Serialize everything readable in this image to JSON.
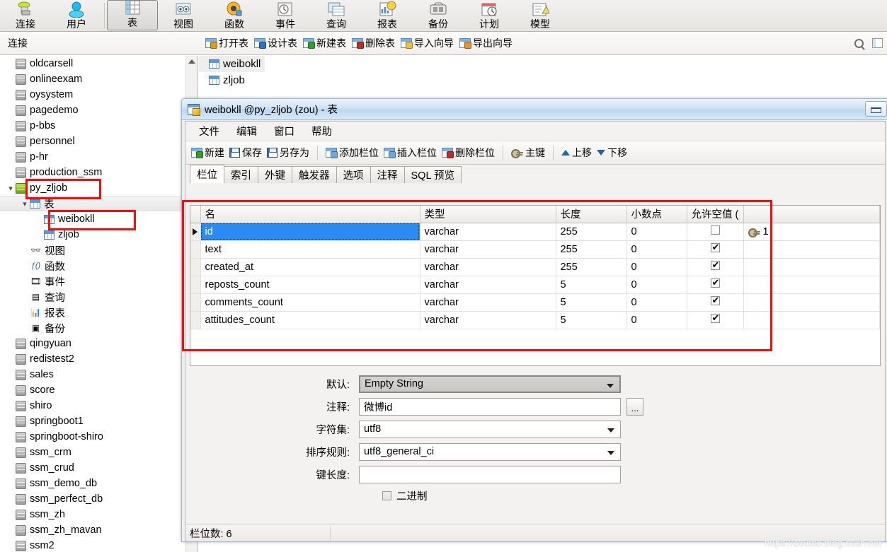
{
  "ribbon": {
    "items": [
      {
        "label": "连接",
        "icon": "connection-icon",
        "selected": false
      },
      {
        "label": "用户",
        "icon": "user-icon",
        "selected": false
      },
      {
        "label": "表",
        "icon": "table-icon",
        "selected": true
      },
      {
        "label": "视图",
        "icon": "view-icon",
        "selected": false
      },
      {
        "label": "函数",
        "icon": "function-icon",
        "selected": false
      },
      {
        "label": "事件",
        "icon": "event-icon",
        "selected": false
      },
      {
        "label": "查询",
        "icon": "query-icon",
        "selected": false
      },
      {
        "label": "报表",
        "icon": "report-icon",
        "selected": false
      },
      {
        "label": "备份",
        "icon": "backup-icon",
        "selected": false
      },
      {
        "label": "计划",
        "icon": "schedule-icon",
        "selected": false
      },
      {
        "label": "模型",
        "icon": "model-icon",
        "selected": false
      }
    ]
  },
  "strip": {
    "left_label": "连接",
    "actions": [
      {
        "label": "打开表",
        "icon": "open-table-icon"
      },
      {
        "label": "设计表",
        "icon": "design-table-icon"
      },
      {
        "label": "新建表",
        "icon": "new-table-icon"
      },
      {
        "label": "删除表",
        "icon": "delete-table-icon"
      },
      {
        "label": "导入向导",
        "icon": "import-wizard-icon"
      },
      {
        "label": "导出向导",
        "icon": "export-wizard-icon"
      }
    ],
    "search_icon": "search-icon",
    "grid_icon": "grid-view-icon"
  },
  "tree": {
    "items": [
      {
        "label": "oldcarsell",
        "indent": 1,
        "icon": "database-icon",
        "twisty": "",
        "highlight": false
      },
      {
        "label": "onlineexam",
        "indent": 1,
        "icon": "database-icon",
        "twisty": "",
        "highlight": false
      },
      {
        "label": "oysystem",
        "indent": 1,
        "icon": "database-icon",
        "twisty": "",
        "highlight": false
      },
      {
        "label": "pagedemo",
        "indent": 1,
        "icon": "database-icon",
        "twisty": "",
        "highlight": false
      },
      {
        "label": "p-bbs",
        "indent": 1,
        "icon": "database-icon",
        "twisty": "",
        "highlight": false
      },
      {
        "label": "personnel",
        "indent": 1,
        "icon": "database-icon",
        "twisty": "",
        "highlight": false
      },
      {
        "label": "p-hr",
        "indent": 1,
        "icon": "database-icon",
        "twisty": "",
        "highlight": false
      },
      {
        "label": "production_ssm",
        "indent": 1,
        "icon": "database-icon",
        "twisty": "",
        "highlight": false
      },
      {
        "label": "py_zljob",
        "indent": 1,
        "icon": "database-open-icon",
        "twisty": "expanded",
        "highlight": false
      },
      {
        "label": "表",
        "indent": 2,
        "icon": "table-folder-icon",
        "twisty": "expanded",
        "highlight": true
      },
      {
        "label": "weibokll",
        "indent": 3,
        "icon": "table-icon",
        "twisty": "",
        "highlight": false
      },
      {
        "label": "zljob",
        "indent": 3,
        "icon": "table-icon",
        "twisty": "",
        "highlight": false
      },
      {
        "label": "视图",
        "indent": 2,
        "icon": "view-icon",
        "twisty": "",
        "highlight": false
      },
      {
        "label": "函数",
        "indent": 2,
        "icon": "function-icon",
        "twisty": "",
        "highlight": false
      },
      {
        "label": "事件",
        "indent": 2,
        "icon": "event-icon",
        "twisty": "",
        "highlight": false
      },
      {
        "label": "查询",
        "indent": 2,
        "icon": "query-icon",
        "twisty": "",
        "highlight": false
      },
      {
        "label": "报表",
        "indent": 2,
        "icon": "report-icon",
        "twisty": "",
        "highlight": false
      },
      {
        "label": "备份",
        "indent": 2,
        "icon": "backup-icon",
        "twisty": "",
        "highlight": false
      },
      {
        "label": "qingyuan",
        "indent": 1,
        "icon": "database-icon",
        "twisty": "",
        "highlight": false
      },
      {
        "label": "redistest2",
        "indent": 1,
        "icon": "database-icon",
        "twisty": "",
        "highlight": false
      },
      {
        "label": "sales",
        "indent": 1,
        "icon": "database-icon",
        "twisty": "",
        "highlight": false
      },
      {
        "label": "score",
        "indent": 1,
        "icon": "database-icon",
        "twisty": "",
        "highlight": false
      },
      {
        "label": "shiro",
        "indent": 1,
        "icon": "database-icon",
        "twisty": "",
        "highlight": false
      },
      {
        "label": "springboot1",
        "indent": 1,
        "icon": "database-icon",
        "twisty": "",
        "highlight": false
      },
      {
        "label": "springboot-shiro",
        "indent": 1,
        "icon": "database-icon",
        "twisty": "",
        "highlight": false
      },
      {
        "label": "ssm_crm",
        "indent": 1,
        "icon": "database-icon",
        "twisty": "",
        "highlight": false
      },
      {
        "label": "ssm_crud",
        "indent": 1,
        "icon": "database-icon",
        "twisty": "",
        "highlight": false
      },
      {
        "label": "ssm_demo_db",
        "indent": 1,
        "icon": "database-icon",
        "twisty": "",
        "highlight": false
      },
      {
        "label": "ssm_perfect_db",
        "indent": 1,
        "icon": "database-icon",
        "twisty": "",
        "highlight": false
      },
      {
        "label": "ssm_zh",
        "indent": 1,
        "icon": "database-icon",
        "twisty": "",
        "highlight": false
      },
      {
        "label": "ssm_zh_mavan",
        "indent": 1,
        "icon": "database-icon",
        "twisty": "",
        "highlight": false
      },
      {
        "label": "ssm2",
        "indent": 1,
        "icon": "database-icon",
        "twisty": "",
        "highlight": false
      }
    ]
  },
  "object_list": {
    "items": [
      {
        "label": "weibokll",
        "selected": true
      },
      {
        "label": "zljob",
        "selected": false
      }
    ]
  },
  "dialog": {
    "title": "weibokll @py_zljob (zou) - 表",
    "title_icon": "design-table-icon",
    "restore_button": "restore-window-button",
    "menu": [
      "文件",
      "编辑",
      "窗口",
      "帮助"
    ],
    "toolbar": [
      {
        "label": "新建",
        "icon": "new-field-icon"
      },
      {
        "label": "保存",
        "icon": "save-icon"
      },
      {
        "label": "另存为",
        "icon": "save-as-icon"
      },
      {
        "label": "添加栏位",
        "icon": "add-field-icon"
      },
      {
        "label": "插入栏位",
        "icon": "insert-field-icon"
      },
      {
        "label": "删除栏位",
        "icon": "delete-field-icon"
      },
      {
        "label": "主键",
        "icon": "primary-key-icon"
      },
      {
        "label": "上移",
        "icon": "move-up-icon"
      },
      {
        "label": "下移",
        "icon": "move-down-icon"
      }
    ],
    "tabs": [
      {
        "label": "栏位",
        "active": true
      },
      {
        "label": "索引",
        "active": false
      },
      {
        "label": "外键",
        "active": false
      },
      {
        "label": "触发器",
        "active": false
      },
      {
        "label": "选项",
        "active": false
      },
      {
        "label": "注释",
        "active": false
      },
      {
        "label": "SQL 预览",
        "active": false
      }
    ],
    "grid": {
      "headers": [
        "名",
        "类型",
        "长度",
        "小数点",
        "允许空值 (",
        ""
      ],
      "rows": [
        {
          "name": "id",
          "type": "varchar",
          "length": "255",
          "decimals": "0",
          "nullable": false,
          "key": "1",
          "selected": true
        },
        {
          "name": "text",
          "type": "varchar",
          "length": "255",
          "decimals": "0",
          "nullable": true,
          "key": "",
          "selected": false
        },
        {
          "name": "created_at",
          "type": "varchar",
          "length": "255",
          "decimals": "0",
          "nullable": true,
          "key": "",
          "selected": false
        },
        {
          "name": "reposts_count",
          "type": "varchar",
          "length": "5",
          "decimals": "0",
          "nullable": true,
          "key": "",
          "selected": false
        },
        {
          "name": "comments_count",
          "type": "varchar",
          "length": "5",
          "decimals": "0",
          "nullable": true,
          "key": "",
          "selected": false
        },
        {
          "name": "attitudes_count",
          "type": "varchar",
          "length": "5",
          "decimals": "0",
          "nullable": true,
          "key": "",
          "selected": false
        }
      ]
    },
    "form": {
      "default_label": "默认:",
      "default_value": "Empty String",
      "comment_label": "注释:",
      "comment_value": "微博id",
      "comment_browse": "...",
      "charset_label": "字符集:",
      "charset_value": "utf8",
      "collation_label": "排序规则:",
      "collation_value": "utf8_general_ci",
      "keylen_label": "键长度:",
      "keylen_value": "",
      "binary_label": "二进制",
      "binary_checked": false
    },
    "status": {
      "field_count": "栏位数: 6",
      "right_cell": ""
    }
  },
  "watermark": "https://zoutao.blog.csdn.net",
  "colors": {
    "accent_blue": "#2a8bf2",
    "annotation_red": "#fb0b07",
    "title_blue": "#bcd6ef"
  }
}
